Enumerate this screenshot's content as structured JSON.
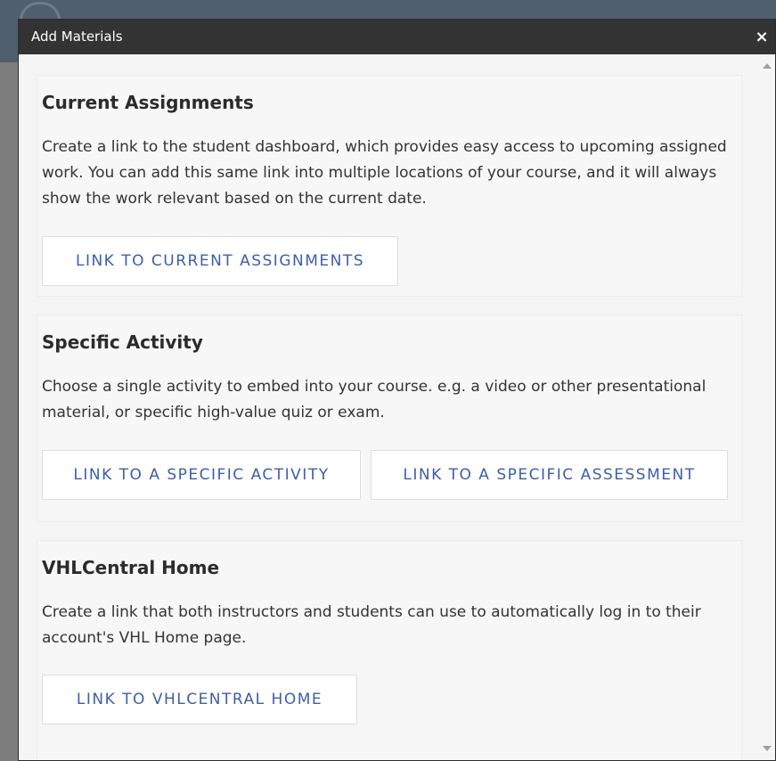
{
  "dialog": {
    "title": "Add Materials",
    "close_glyph": "×"
  },
  "sections": [
    {
      "heading": "Current Assignments",
      "description": "Create a link to the student dashboard, which provides easy access to upcoming assigned work. You can add this same link into multiple locations of your course, and it will always show the work relevant based on the current date.",
      "buttons": [
        "LINK TO CURRENT ASSIGNMENTS"
      ]
    },
    {
      "heading": "Specific Activity",
      "description": "Choose a single activity to embed into your course. e.g. a video or other presentational material, or specific high-value quiz or exam.",
      "buttons": [
        "LINK TO A SPECIFIC ACTIVITY",
        "LINK TO A SPECIFIC ASSESSMENT"
      ]
    },
    {
      "heading": "VHLCentral Home",
      "description": "Create a link that both instructors and students can use to automatically log in to their account's VHL Home page.",
      "buttons": [
        "LINK TO VHLCENTRAL HOME"
      ]
    }
  ],
  "colors": {
    "titlebar": "#333333",
    "button_text": "#3d5fa8",
    "backdrop": "#7d7d7d",
    "backdrop_header": "#4f5f6e"
  },
  "icons": {
    "close": "close-icon",
    "scroll_up": "scroll-up-arrow-icon",
    "scroll_down": "scroll-down-arrow-icon"
  }
}
